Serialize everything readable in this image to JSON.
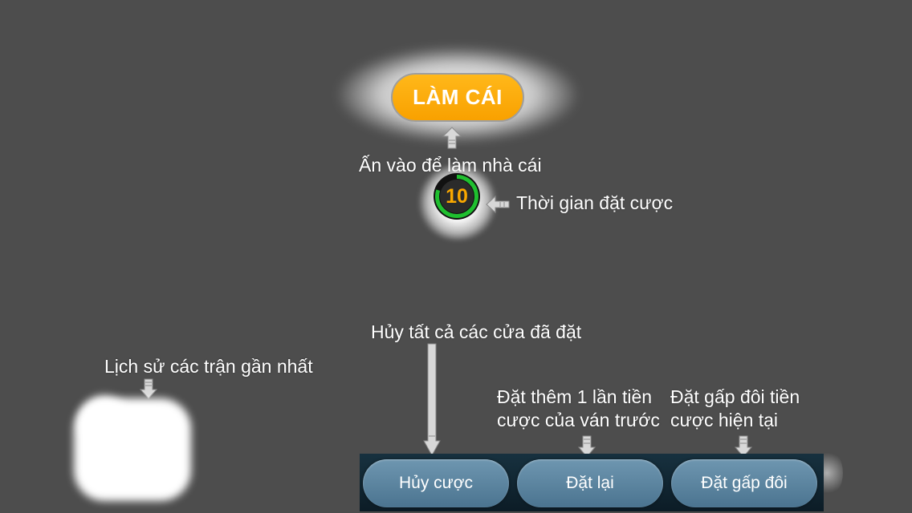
{
  "banker": {
    "label": "LÀM CÁI",
    "hint": "Ấn vào để làm nhà cái"
  },
  "timer": {
    "value": "10",
    "hint": "Thời gian đặt cược",
    "ring_fraction_remaining": 0.8
  },
  "history": {
    "hint": "Lịch sử các trận gần nhất"
  },
  "cancel_all_hint": "Hủy tất cả các cửa đã đặt",
  "rebet_hint": [
    "Đặt thêm 1 lần tiền",
    "cược của ván trước"
  ],
  "double_hint": [
    "Đặt gấp đôi tiền",
    "cược hiện tại"
  ],
  "buttons": {
    "cancel": "Hủy cược",
    "rebet": "Đặt lại",
    "double": "Đặt gấp đôi"
  },
  "colors": {
    "background": "#4d4d4d",
    "banker_button": "#f9a100",
    "timer_ring": "#1fbf2f",
    "timer_number": "#f9a800",
    "action_button": "#5e86a2"
  }
}
